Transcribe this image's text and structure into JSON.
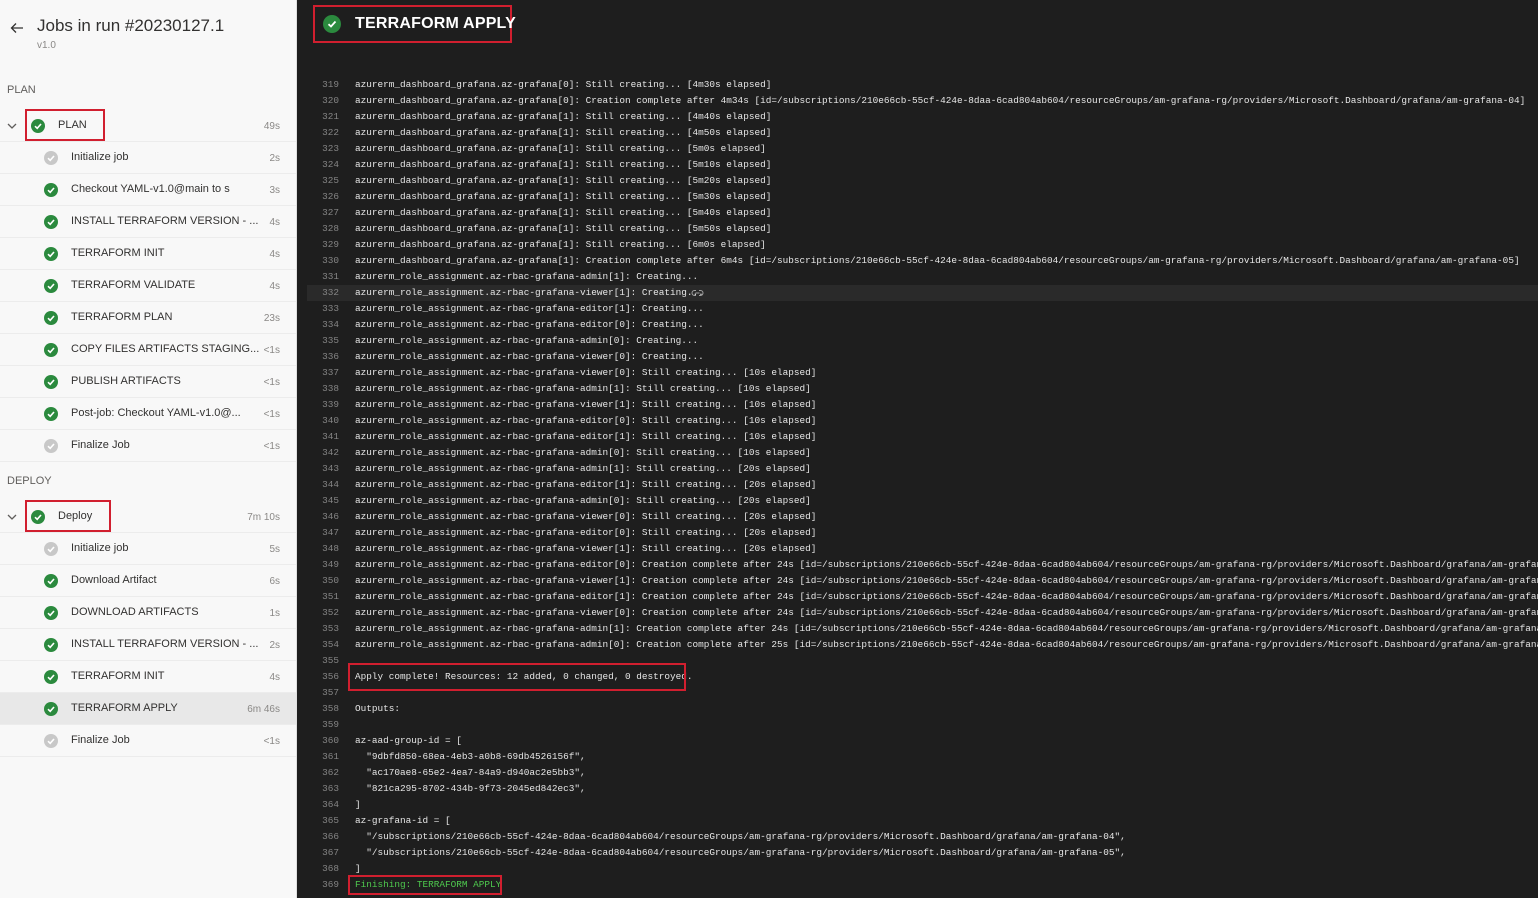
{
  "header": {
    "title": "Jobs in run #20230127.1",
    "subtitle": "v1.0"
  },
  "stages": [
    {
      "label": "PLAN",
      "name": "PLAN",
      "duration": "49s",
      "jobs": [
        {
          "name": "Initialize job",
          "duration": "2s",
          "status": "pending"
        },
        {
          "name": "Checkout YAML-v1.0@main to s",
          "duration": "3s",
          "status": "ok"
        },
        {
          "name": "INSTALL TERRAFORM VERSION - ...",
          "duration": "4s",
          "status": "ok"
        },
        {
          "name": "TERRAFORM INIT",
          "duration": "4s",
          "status": "ok"
        },
        {
          "name": "TERRAFORM VALIDATE",
          "duration": "4s",
          "status": "ok"
        },
        {
          "name": "TERRAFORM PLAN",
          "duration": "23s",
          "status": "ok"
        },
        {
          "name": "COPY FILES ARTIFACTS STAGING...",
          "duration": "<1s",
          "status": "ok"
        },
        {
          "name": "PUBLISH ARTIFACTS",
          "duration": "<1s",
          "status": "ok"
        },
        {
          "name": "Post-job: Checkout YAML-v1.0@...",
          "duration": "<1s",
          "status": "ok"
        },
        {
          "name": "Finalize Job",
          "duration": "<1s",
          "status": "pending"
        }
      ]
    },
    {
      "label": "DEPLOY",
      "name": "Deploy",
      "duration": "7m 10s",
      "jobs": [
        {
          "name": "Initialize job",
          "duration": "5s",
          "status": "pending"
        },
        {
          "name": "Download Artifact",
          "duration": "6s",
          "status": "ok"
        },
        {
          "name": "DOWNLOAD ARTIFACTS",
          "duration": "1s",
          "status": "ok"
        },
        {
          "name": "INSTALL TERRAFORM VERSION - ...",
          "duration": "2s",
          "status": "ok"
        },
        {
          "name": "TERRAFORM INIT",
          "duration": "4s",
          "status": "ok"
        },
        {
          "name": "TERRAFORM APPLY",
          "duration": "6m 46s",
          "status": "ok",
          "selected": true
        },
        {
          "name": "Finalize Job",
          "duration": "<1s",
          "status": "pending"
        }
      ]
    }
  ],
  "main": {
    "title": "TERRAFORM APPLY",
    "log": [
      {
        "n": "319",
        "t": "azurerm_dashboard_grafana.az-grafana[0]: Still creating... [4m30s elapsed]"
      },
      {
        "n": "320",
        "t": "azurerm_dashboard_grafana.az-grafana[0]: Creation complete after 4m34s [id=/subscriptions/210e66cb-55cf-424e-8daa-6cad804ab604/resourceGroups/am-grafana-rg/providers/Microsoft.Dashboard/grafana/am-grafana-04]"
      },
      {
        "n": "321",
        "t": "azurerm_dashboard_grafana.az-grafana[1]: Still creating... [4m40s elapsed]"
      },
      {
        "n": "322",
        "t": "azurerm_dashboard_grafana.az-grafana[1]: Still creating... [4m50s elapsed]"
      },
      {
        "n": "323",
        "t": "azurerm_dashboard_grafana.az-grafana[1]: Still creating... [5m0s elapsed]"
      },
      {
        "n": "324",
        "t": "azurerm_dashboard_grafana.az-grafana[1]: Still creating... [5m10s elapsed]"
      },
      {
        "n": "325",
        "t": "azurerm_dashboard_grafana.az-grafana[1]: Still creating... [5m20s elapsed]"
      },
      {
        "n": "326",
        "t": "azurerm_dashboard_grafana.az-grafana[1]: Still creating... [5m30s elapsed]"
      },
      {
        "n": "327",
        "t": "azurerm_dashboard_grafana.az-grafana[1]: Still creating... [5m40s elapsed]"
      },
      {
        "n": "328",
        "t": "azurerm_dashboard_grafana.az-grafana[1]: Still creating... [5m50s elapsed]"
      },
      {
        "n": "329",
        "t": "azurerm_dashboard_grafana.az-grafana[1]: Still creating... [6m0s elapsed]"
      },
      {
        "n": "330",
        "t": "azurerm_dashboard_grafana.az-grafana[1]: Creation complete after 6m4s [id=/subscriptions/210e66cb-55cf-424e-8daa-6cad804ab604/resourceGroups/am-grafana-rg/providers/Microsoft.Dashboard/grafana/am-grafana-05]"
      },
      {
        "n": "331",
        "t": "azurerm_role_assignment.az-rbac-grafana-admin[1]: Creating..."
      },
      {
        "n": "332",
        "t": "azurerm_role_assignment.az-rbac-grafana-viewer[1]: Creating...",
        "active": true
      },
      {
        "n": "333",
        "t": "azurerm_role_assignment.az-rbac-grafana-editor[1]: Creating..."
      },
      {
        "n": "334",
        "t": "azurerm_role_assignment.az-rbac-grafana-editor[0]: Creating..."
      },
      {
        "n": "335",
        "t": "azurerm_role_assignment.az-rbac-grafana-admin[0]: Creating..."
      },
      {
        "n": "336",
        "t": "azurerm_role_assignment.az-rbac-grafana-viewer[0]: Creating..."
      },
      {
        "n": "337",
        "t": "azurerm_role_assignment.az-rbac-grafana-viewer[0]: Still creating... [10s elapsed]"
      },
      {
        "n": "338",
        "t": "azurerm_role_assignment.az-rbac-grafana-admin[1]: Still creating... [10s elapsed]"
      },
      {
        "n": "339",
        "t": "azurerm_role_assignment.az-rbac-grafana-viewer[1]: Still creating... [10s elapsed]"
      },
      {
        "n": "340",
        "t": "azurerm_role_assignment.az-rbac-grafana-editor[0]: Still creating... [10s elapsed]"
      },
      {
        "n": "341",
        "t": "azurerm_role_assignment.az-rbac-grafana-editor[1]: Still creating... [10s elapsed]"
      },
      {
        "n": "342",
        "t": "azurerm_role_assignment.az-rbac-grafana-admin[0]: Still creating... [10s elapsed]"
      },
      {
        "n": "343",
        "t": "azurerm_role_assignment.az-rbac-grafana-admin[1]: Still creating... [20s elapsed]"
      },
      {
        "n": "344",
        "t": "azurerm_role_assignment.az-rbac-grafana-editor[1]: Still creating... [20s elapsed]"
      },
      {
        "n": "345",
        "t": "azurerm_role_assignment.az-rbac-grafana-admin[0]: Still creating... [20s elapsed]"
      },
      {
        "n": "346",
        "t": "azurerm_role_assignment.az-rbac-grafana-viewer[0]: Still creating... [20s elapsed]"
      },
      {
        "n": "347",
        "t": "azurerm_role_assignment.az-rbac-grafana-editor[0]: Still creating... [20s elapsed]"
      },
      {
        "n": "348",
        "t": "azurerm_role_assignment.az-rbac-grafana-viewer[1]: Still creating... [20s elapsed]"
      },
      {
        "n": "349",
        "t": "azurerm_role_assignment.az-rbac-grafana-editor[0]: Creation complete after 24s [id=/subscriptions/210e66cb-55cf-424e-8daa-6cad804ab604/resourceGroups/am-grafana-rg/providers/Microsoft.Dashboard/grafana/am-grafana-04/provider"
      },
      {
        "n": "350",
        "t": "azurerm_role_assignment.az-rbac-grafana-viewer[1]: Creation complete after 24s [id=/subscriptions/210e66cb-55cf-424e-8daa-6cad804ab604/resourceGroups/am-grafana-rg/providers/Microsoft.Dashboard/grafana/am-grafana-05/provider"
      },
      {
        "n": "351",
        "t": "azurerm_role_assignment.az-rbac-grafana-editor[1]: Creation complete after 24s [id=/subscriptions/210e66cb-55cf-424e-8daa-6cad804ab604/resourceGroups/am-grafana-rg/providers/Microsoft.Dashboard/grafana/am-grafana-05/provider"
      },
      {
        "n": "352",
        "t": "azurerm_role_assignment.az-rbac-grafana-viewer[0]: Creation complete after 24s [id=/subscriptions/210e66cb-55cf-424e-8daa-6cad804ab604/resourceGroups/am-grafana-rg/providers/Microsoft.Dashboard/grafana/am-grafana-04/provider"
      },
      {
        "n": "353",
        "t": "azurerm_role_assignment.az-rbac-grafana-admin[1]: Creation complete after 24s [id=/subscriptions/210e66cb-55cf-424e-8daa-6cad804ab604/resourceGroups/am-grafana-rg/providers/Microsoft.Dashboard/grafana/am-grafana-05/providers"
      },
      {
        "n": "354",
        "t": "azurerm_role_assignment.az-rbac-grafana-admin[0]: Creation complete after 25s [id=/subscriptions/210e66cb-55cf-424e-8daa-6cad804ab604/resourceGroups/am-grafana-rg/providers/Microsoft.Dashboard/grafana/am-grafana-04/providers"
      },
      {
        "n": "355",
        "t": ""
      },
      {
        "n": "356",
        "t": "Apply complete! Resources: 12 added, 0 changed, 0 destroyed."
      },
      {
        "n": "357",
        "t": ""
      },
      {
        "n": "358",
        "t": "Outputs:"
      },
      {
        "n": "359",
        "t": ""
      },
      {
        "n": "360",
        "t": "az-aad-group-id = ["
      },
      {
        "n": "361",
        "t": "  \"9dbfd850-68ea-4eb3-a0b8-69db4526156f\","
      },
      {
        "n": "362",
        "t": "  \"ac170ae8-65e2-4ea7-84a9-d940ac2e5bb3\","
      },
      {
        "n": "363",
        "t": "  \"821ca295-8702-434b-9f73-2045ed842ec3\","
      },
      {
        "n": "364",
        "t": "]"
      },
      {
        "n": "365",
        "t": "az-grafana-id = ["
      },
      {
        "n": "366",
        "t": "  \"/subscriptions/210e66cb-55cf-424e-8daa-6cad804ab604/resourceGroups/am-grafana-rg/providers/Microsoft.Dashboard/grafana/am-grafana-04\","
      },
      {
        "n": "367",
        "t": "  \"/subscriptions/210e66cb-55cf-424e-8daa-6cad804ab604/resourceGroups/am-grafana-rg/providers/Microsoft.Dashboard/grafana/am-grafana-05\","
      },
      {
        "n": "368",
        "t": "]"
      },
      {
        "n": "369",
        "t": "Finishing: TERRAFORM APPLY",
        "green": true
      }
    ]
  },
  "colors": {
    "success": "#2b8a3e",
    "highlight": "#d11f2f",
    "log_bg": "#1e1e1e",
    "sidebar_bg": "#f8f8f8",
    "finishing": "#4ec94e"
  },
  "icons": {
    "back": "arrow-left-icon",
    "collapse": "chevron-down-icon",
    "status_ok": "check-circle-icon",
    "status_pending": "check-circle-grey-icon",
    "copy_link": "link-icon"
  }
}
